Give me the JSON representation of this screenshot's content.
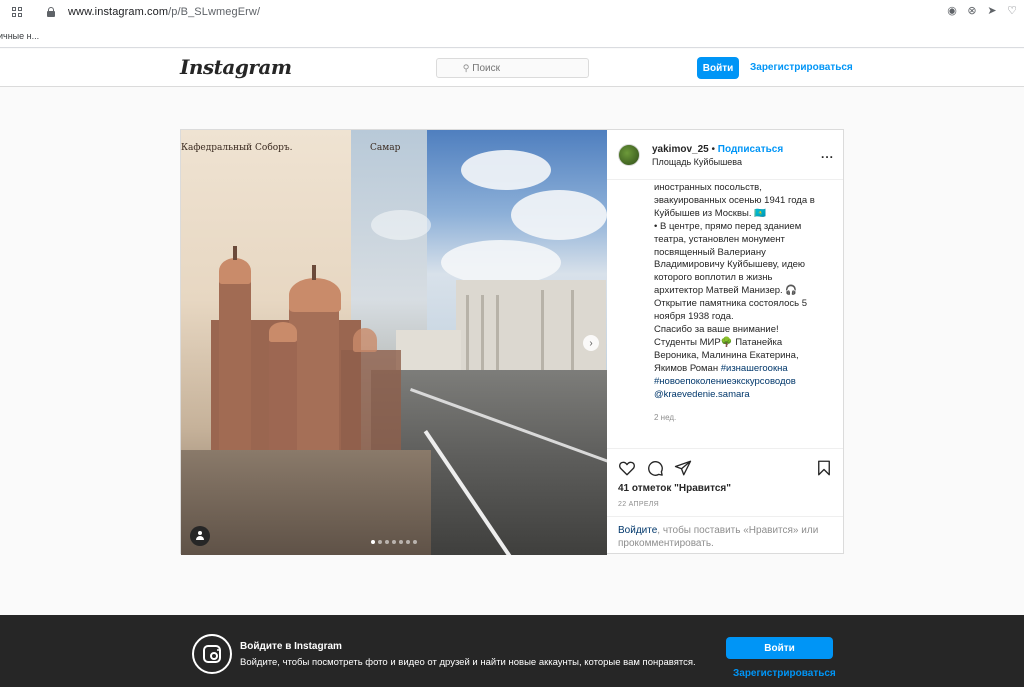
{
  "browser": {
    "url_host": "www.instagram.com",
    "url_path": "/p/B_SLwmegErw/",
    "bookmark_label": "ичные н..."
  },
  "header": {
    "logo": "Instagram",
    "search_placeholder": "Поиск",
    "login_label": "Войти",
    "register_label": "Зарегистрироваться"
  },
  "post": {
    "photo_caption_left": "Кафедральный Соборъ.",
    "photo_caption_mid": "Самар",
    "carousel_dots": 7,
    "carousel_active": 1,
    "username": "yakimov_25",
    "separator": "•",
    "follow_label": "Подписаться",
    "location": "Площадь Куйбышева",
    "more_label": "...",
    "caption_lines": [
      "иностранных посольств,",
      "эвакуированных осенью 1941 года в",
      "Куйбышев из Москвы. 🇰🇿",
      "• В центре, прямо перед зданием",
      "театра, установлен монумент",
      "посвященный Валериану",
      "Владимировичу Куйбышеву, идею",
      "которого воплотил в жизнь",
      "архитектор Матвей Манизер. 🎧",
      "Открытие памятника состоялось 5",
      "ноября 1938 года.",
      "Спасибо за ваше внимание!",
      "Студенты МИР🌳 Патанейка",
      "Вероника, Малинина Екатерина,",
      "Якимов Роман"
    ],
    "hashtag_inline": "#изнашегоокна",
    "hashtag_line": "#новоепоколениеэкскурсоводов",
    "mention_line": "@kraevedenie.samara",
    "time_ago": "2 нед.",
    "likes": "41 отметок \"Нравится\"",
    "date": "22 АПРЕЛЯ",
    "login_prompt_link": "Войдите",
    "login_prompt_text": ", чтобы поставить «Нравится» или прокомментировать."
  },
  "banner": {
    "title": "Войдите в Instagram",
    "text": "Войдите, чтобы посмотреть фото и видео от друзей и найти новые аккаунты, которые вам понравятся.",
    "login_label": "Войти",
    "register_label": "Зарегистрироваться"
  },
  "colors": {
    "accent": "#0095f6",
    "banner_bg": "#262626",
    "link_dark": "#00376b"
  }
}
